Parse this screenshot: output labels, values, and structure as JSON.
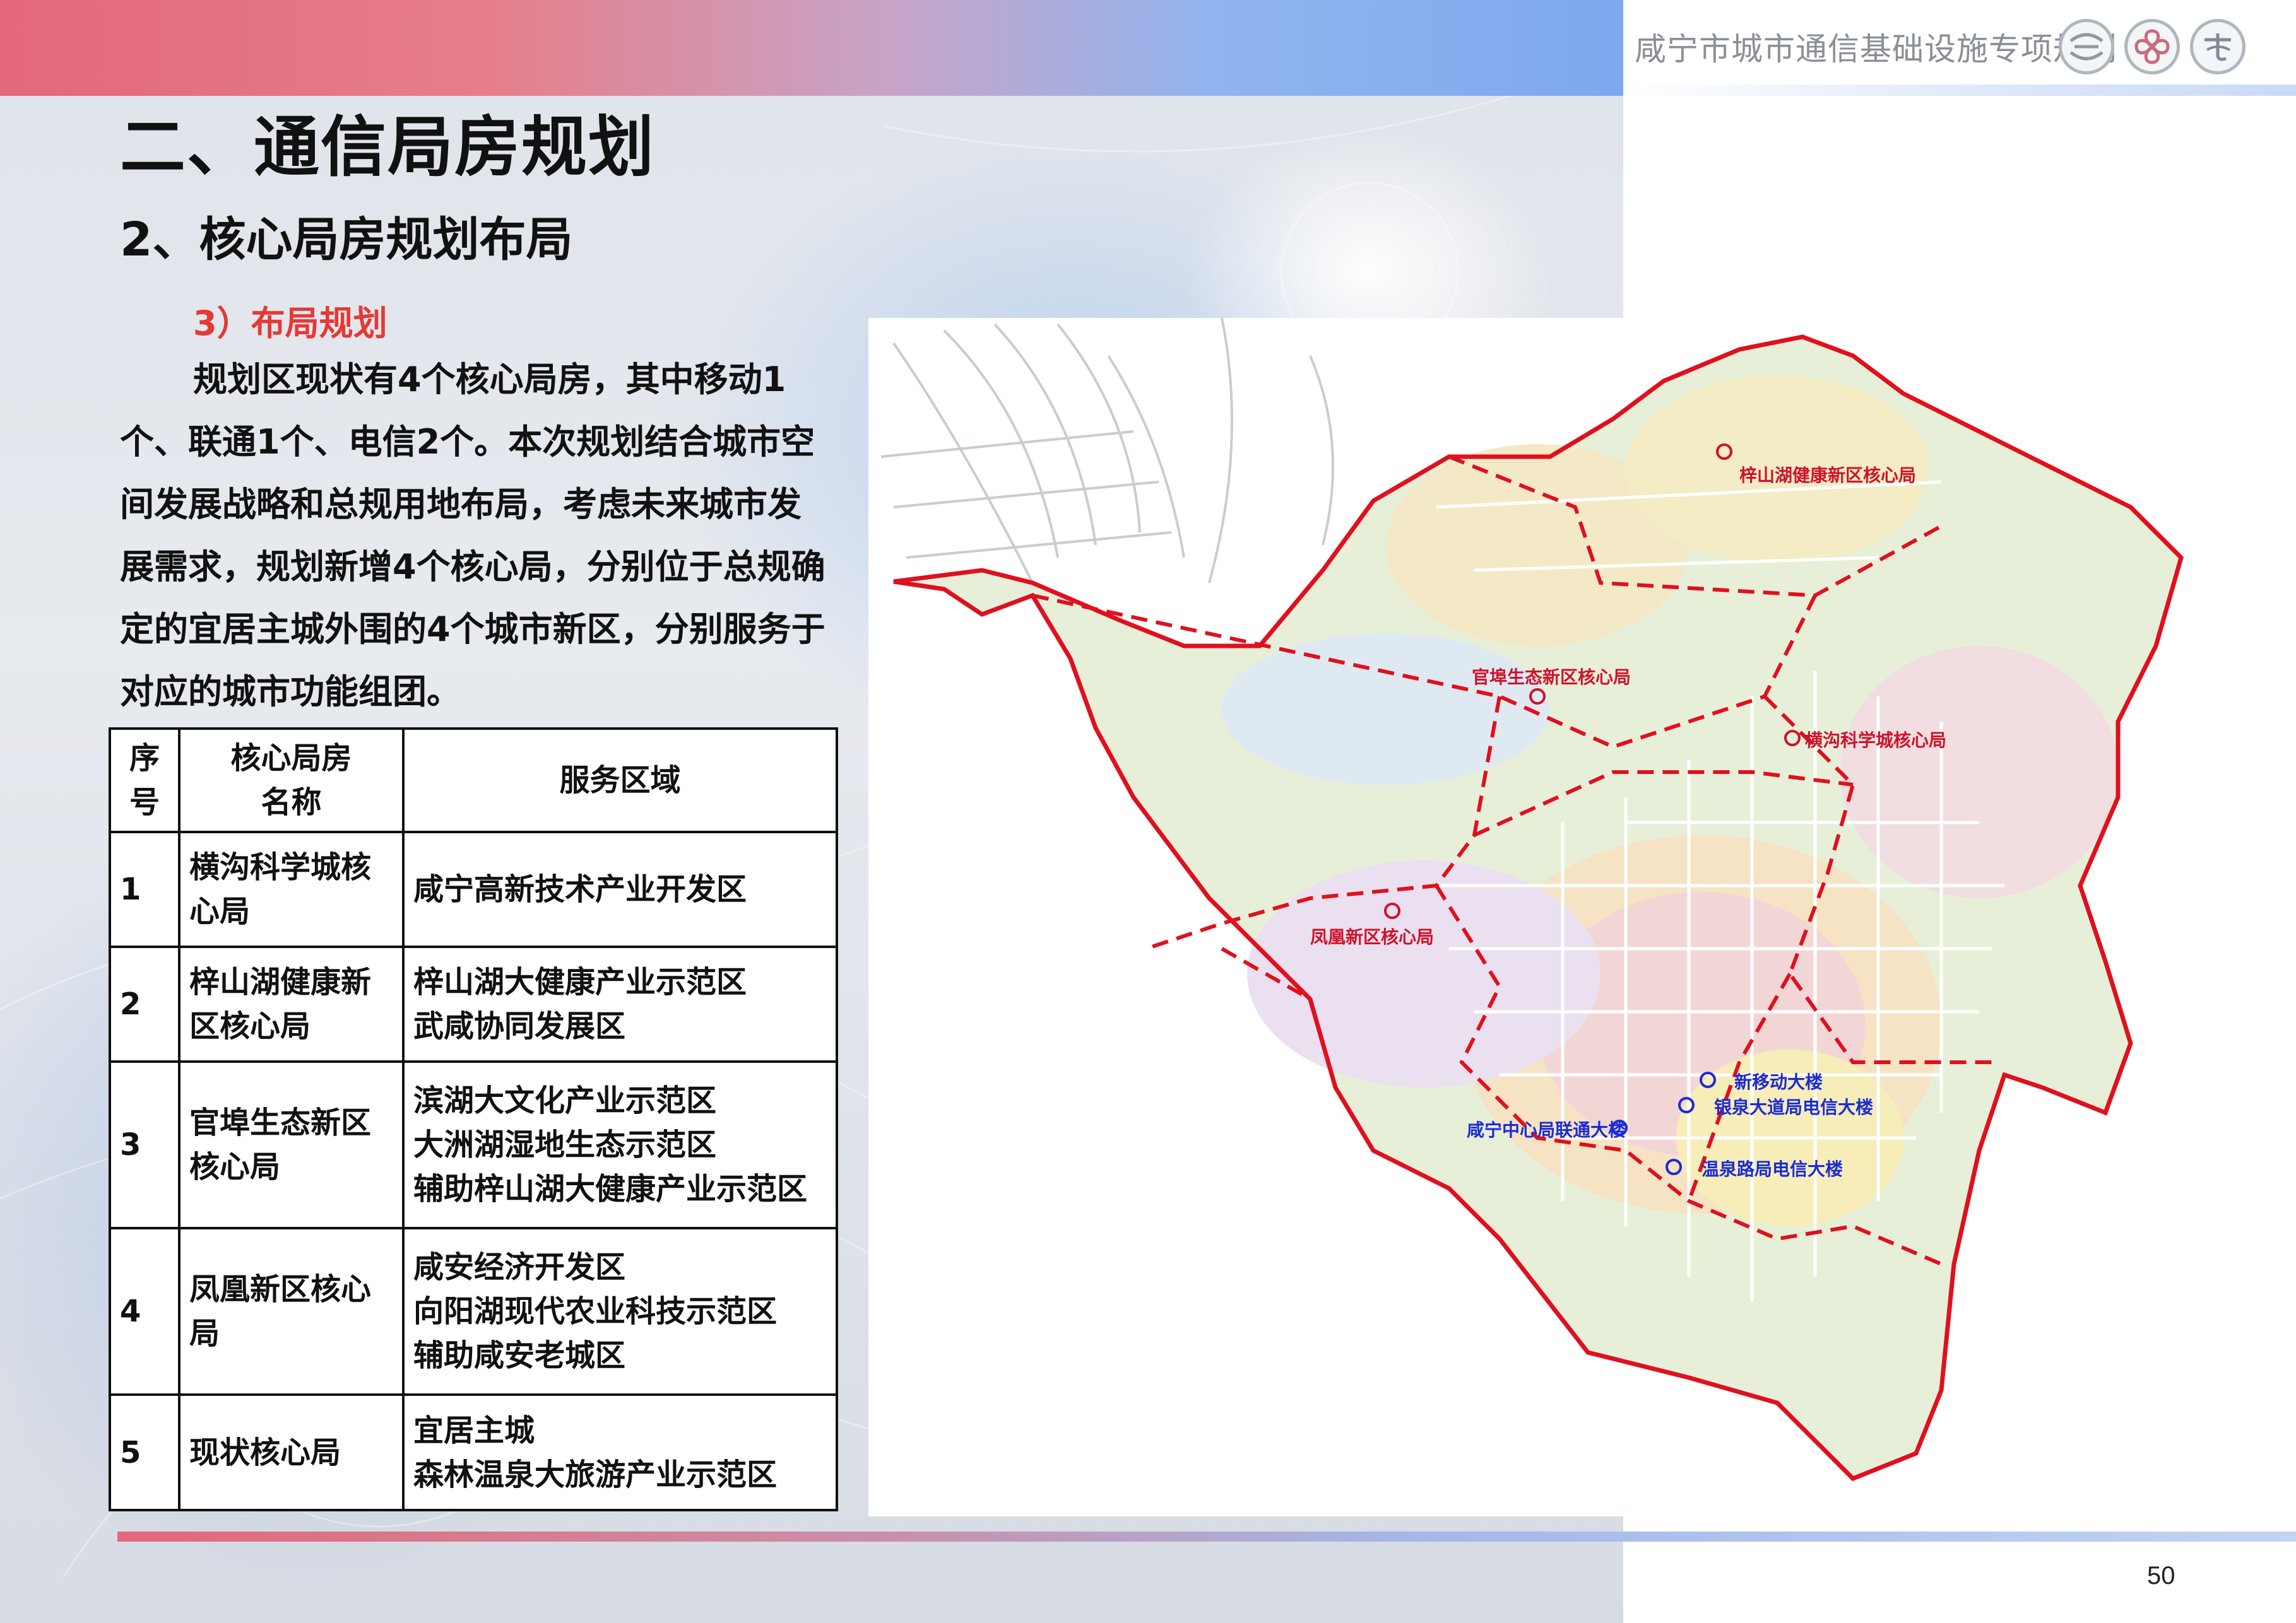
{
  "header": {
    "title": "咸宁市城市通信基础设施专项规划",
    "logos": [
      "china-mobile-logo",
      "china-unicom-logo",
      "china-telecom-logo"
    ]
  },
  "section_title": "二、通信局房规划",
  "subsection_title": "2、核心局房规划布局",
  "sub_subsection_title": "3）布局规划",
  "paragraph": "规划区现状有4个核心局房，其中移动1个、联通1个、电信2个。本次规划结合城市空间发展战略和总规用地布局，考虑未来城市发展需求，规划新增4个核心局，分别位于总规确定的宜居主城外围的4个城市新区，分别服务于对应的城市功能组团。",
  "table": {
    "headers": {
      "index_line1": "序",
      "index_line2": "号",
      "name_line1": "核心局房",
      "name_line2": "名称",
      "area": "服务区域"
    },
    "rows": [
      {
        "index": "1",
        "name1": "横沟科学城核",
        "name2": "心局",
        "areas": [
          "咸宁高新技术产业开发区"
        ]
      },
      {
        "index": "2",
        "name1": "梓山湖健康新",
        "name2": "区核心局",
        "areas": [
          "梓山湖大健康产业示范区",
          "武咸协同发展区"
        ]
      },
      {
        "index": "3",
        "name1": "官埠生态新区",
        "name2": "核心局",
        "areas": [
          "滨湖大文化产业示范区",
          "大洲湖湿地生态示范区",
          "辅助梓山湖大健康产业示范区"
        ]
      },
      {
        "index": "4",
        "name1": "凤凰新区核心",
        "name2": "局",
        "areas": [
          "咸安经济开发区",
          "向阳湖现代农业科技示范区",
          "辅助咸安老城区"
        ]
      },
      {
        "index": "5",
        "name1": "现状核心局",
        "name2": "",
        "areas": [
          "宜居主城",
          "森林温泉大旅游产业示范区"
        ]
      }
    ]
  },
  "map": {
    "symbol": "S",
    "planned_offices": [
      "梓山湖健康新区核心局",
      "官埠生态新区核心局",
      "横沟科学城核心局",
      "凤凰新区核心局"
    ],
    "existing_offices": [
      "新移动大楼",
      "银泉大道局电信大楼",
      "咸宁中心局联通大楼",
      "温泉路局电信大楼"
    ],
    "colors": {
      "planned": "#d0112b",
      "existing": "#1a2bd6",
      "boundary": "#e0101e"
    }
  },
  "page_number": "50"
}
